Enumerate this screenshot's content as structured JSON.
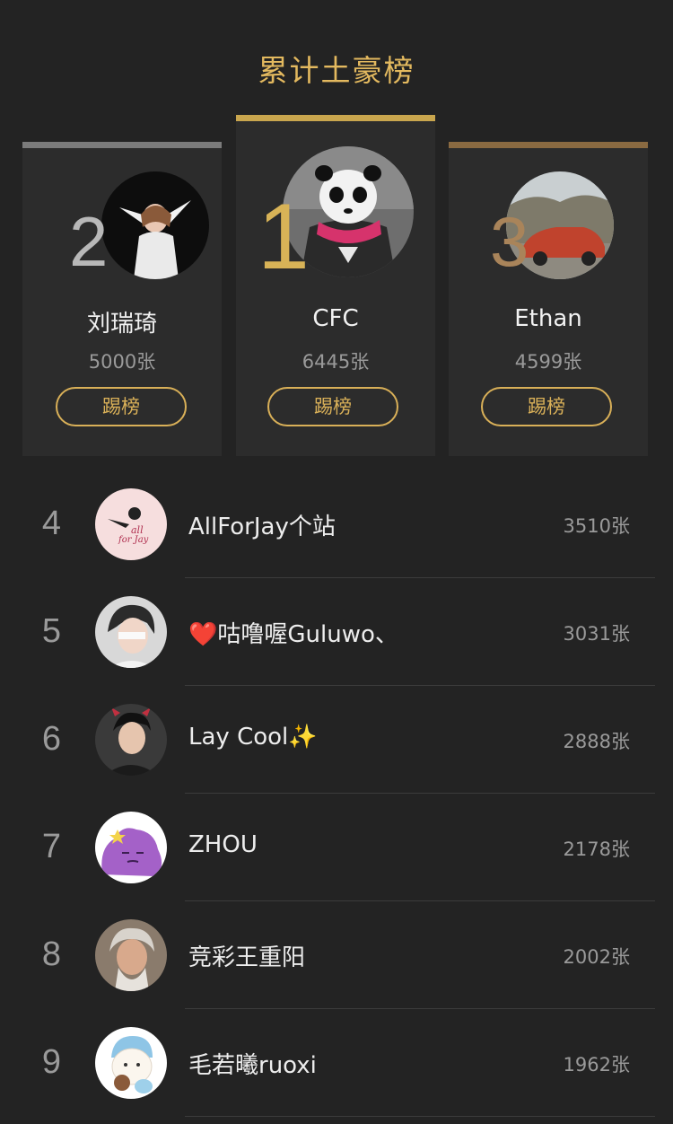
{
  "page": {
    "title": "累计土豪榜"
  },
  "podium": [
    {
      "rank": "2",
      "name": "刘瑞琦",
      "count": "5000张",
      "button": "踢榜",
      "bar_color": "#7b7b7b",
      "rank_color": "#b8b8b8"
    },
    {
      "rank": "1",
      "name": "CFC",
      "count": "6445张",
      "button": "踢榜",
      "bar_color": "#c9a64e",
      "rank_color": "#d8b357"
    },
    {
      "rank": "3",
      "name": "Ethan",
      "count": "4599张",
      "button": "踢榜",
      "bar_color": "#8a6a41",
      "rank_color": "#a9845a"
    }
  ],
  "list": [
    {
      "rank": "4",
      "name": "AllForJay个站",
      "count": "3510张",
      "avatar": "allforjay-logo"
    },
    {
      "rank": "5",
      "name": "❤️咕噜喔Guluwo、",
      "count": "3031张",
      "avatar": "user-photo"
    },
    {
      "rank": "6",
      "name": "Lay Cool✨",
      "count": "2888张",
      "avatar": "user-photo"
    },
    {
      "rank": "7",
      "name": "ZHOU",
      "count": "2178张",
      "avatar": "purple-cartoon"
    },
    {
      "rank": "8",
      "name": "竞彩王重阳",
      "count": "2002张",
      "avatar": "user-photo"
    },
    {
      "rank": "9",
      "name": "毛若曦ruoxi",
      "count": "1962张",
      "avatar": "cartoon-bear"
    }
  ],
  "colors": {
    "accent": "#d9b058",
    "background": "#232323",
    "card": "#2c2c2c"
  }
}
